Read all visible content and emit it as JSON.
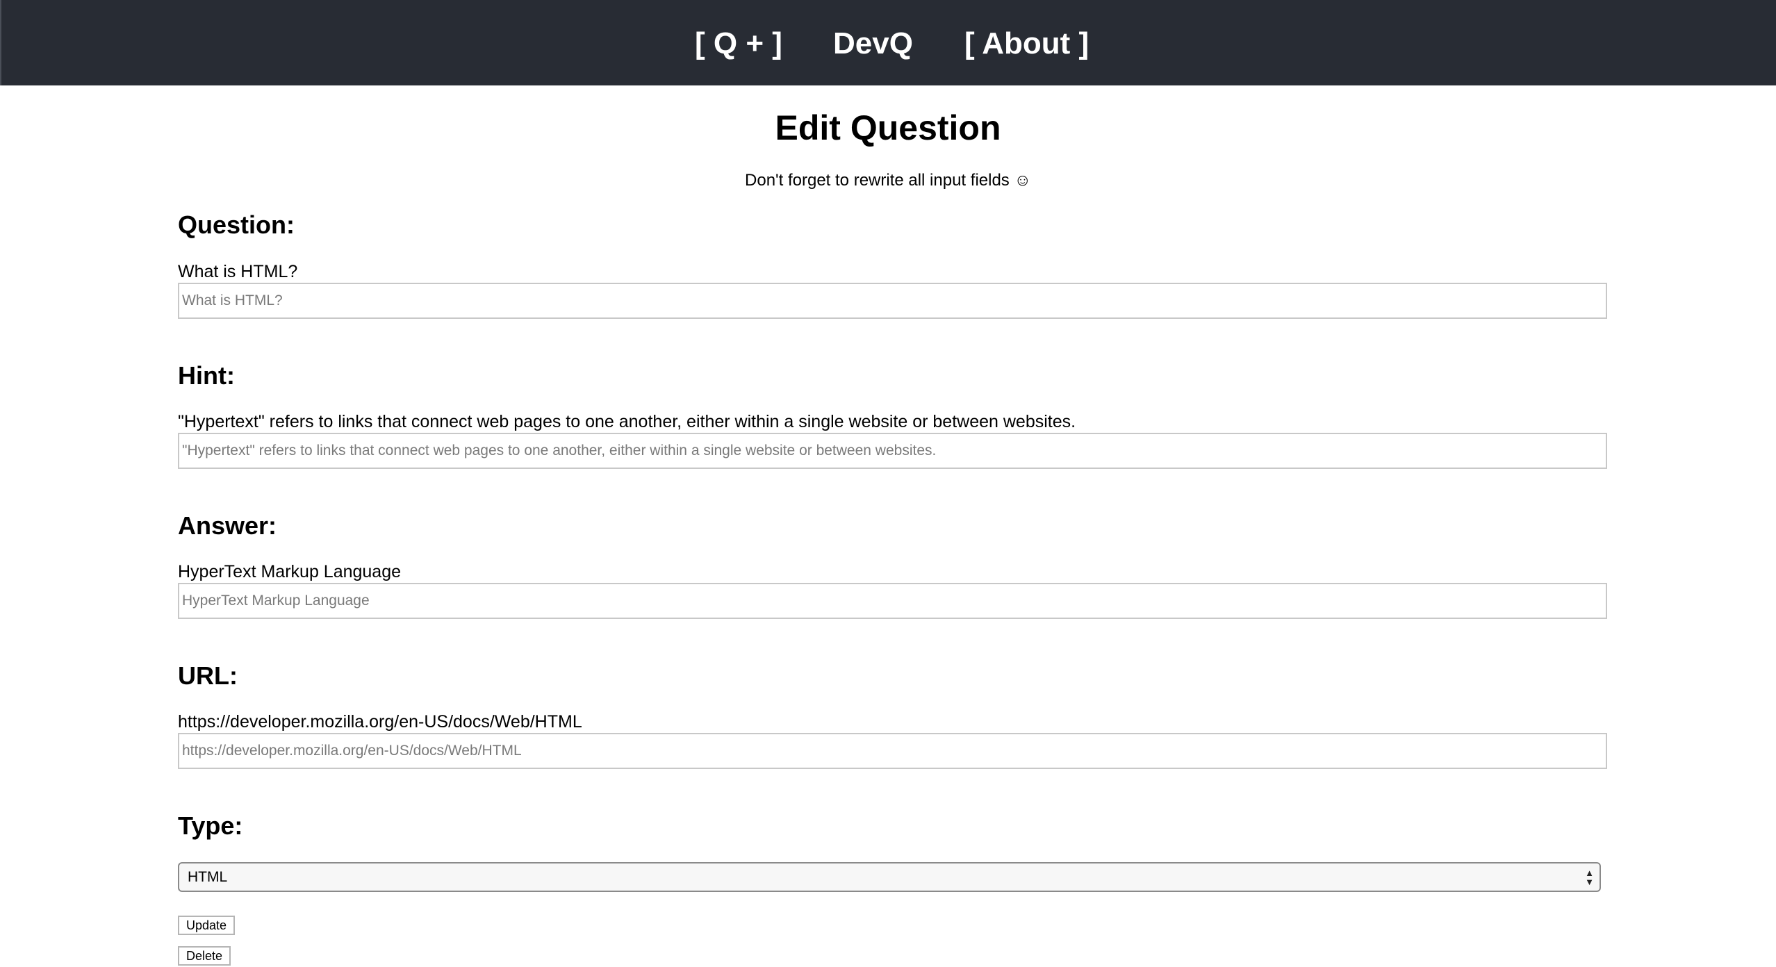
{
  "nav": {
    "new_question": "[ Q + ]",
    "brand": "DevQ",
    "about": "[ About ]"
  },
  "page": {
    "title": "Edit Question",
    "subtitle": "Don't forget to rewrite all input fields ☺"
  },
  "form": {
    "question": {
      "heading": "Question:",
      "current": "What is HTML?",
      "placeholder": "What is HTML?"
    },
    "hint": {
      "heading": "Hint:",
      "current": "\"Hypertext\" refers to links that connect web pages to one another, either within a single website or between websites.",
      "placeholder": "\"Hypertext\" refers to links that connect web pages to one another, either within a single website or between websites."
    },
    "answer": {
      "heading": "Answer:",
      "current": "HyperText Markup Language",
      "placeholder": "HyperText Markup Language"
    },
    "url": {
      "heading": "URL:",
      "current": "https://developer.mozilla.org/en-US/docs/Web/HTML",
      "placeholder": "https://developer.mozilla.org/en-US/docs/Web/HTML"
    },
    "type": {
      "heading": "Type:",
      "selected": "HTML"
    }
  },
  "buttons": {
    "update": "Update",
    "delete": "Delete"
  }
}
